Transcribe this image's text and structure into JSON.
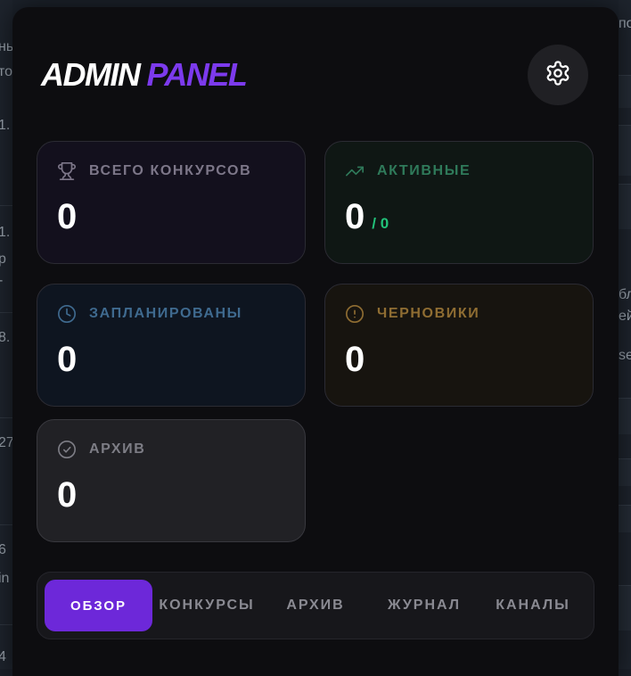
{
  "logo": {
    "word1": "ADMIN",
    "word2": "PANEL"
  },
  "settings": {
    "icon": "gear-icon"
  },
  "stats": {
    "total": {
      "icon": "trophy-icon",
      "label": "ВСЕГО КОНКУРСОВ",
      "value": "0"
    },
    "active": {
      "icon": "trending-up-icon",
      "label": "АКТИВНЫЕ",
      "value": "0",
      "sub": "/ 0"
    },
    "scheduled": {
      "icon": "clock-icon",
      "label": "ЗАПЛАНИРОВАНЫ",
      "value": "0"
    },
    "drafts": {
      "icon": "alert-circle-icon",
      "label": "ЧЕРНОВИКИ",
      "value": "0"
    },
    "archive": {
      "icon": "check-circle-icon",
      "label": "АРХИВ",
      "value": "0"
    }
  },
  "tabs": [
    {
      "label": "ОБЗОР",
      "active": true
    },
    {
      "label": "КОНКУРСЫ",
      "active": false
    },
    {
      "label": "АРХИВ",
      "active": false
    },
    {
      "label": "ЖУРНАЛ",
      "active": false
    },
    {
      "label": "КАНАЛЫ",
      "active": false
    }
  ],
  "colors": {
    "accent": "#6d28d9",
    "logo_accent": "#7c3aed",
    "active_green": "#22c37a",
    "panel_bg": "#0d0d10"
  },
  "background_fragments": {
    "left": [
      "нь",
      "то",
      "1.",
      "1.",
      "р",
      "-",
      "8.",
      "27",
      "6",
      "in",
      "4"
    ],
    "right": [
      "по",
      "бл",
      "ей",
      "se"
    ]
  }
}
